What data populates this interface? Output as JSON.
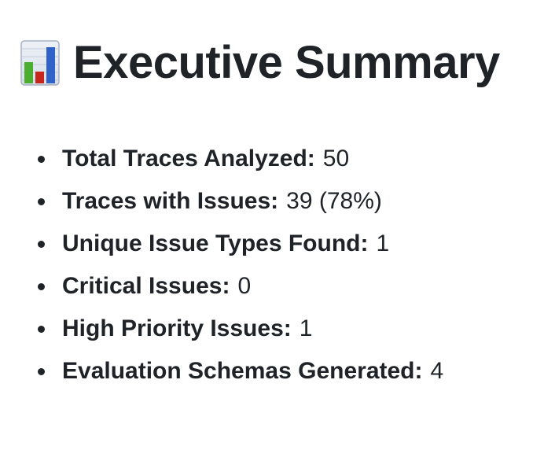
{
  "header": {
    "icon": "bar-chart-icon",
    "title": "Executive Summary"
  },
  "summary": {
    "items": [
      {
        "label": "Total Traces Analyzed:",
        "value": "50"
      },
      {
        "label": "Traces with Issues:",
        "value": "39 (78%)"
      },
      {
        "label": "Unique Issue Types Found:",
        "value": "1"
      },
      {
        "label": "Critical Issues:",
        "value": "0"
      },
      {
        "label": "High Priority Issues:",
        "value": "1"
      },
      {
        "label": "Evaluation Schemas Generated:",
        "value": "4"
      }
    ]
  },
  "colors": {
    "text": "#1f2328",
    "icon_green": "#4cae2e",
    "icon_red": "#c7261c",
    "icon_blue": "#2f63c7"
  }
}
